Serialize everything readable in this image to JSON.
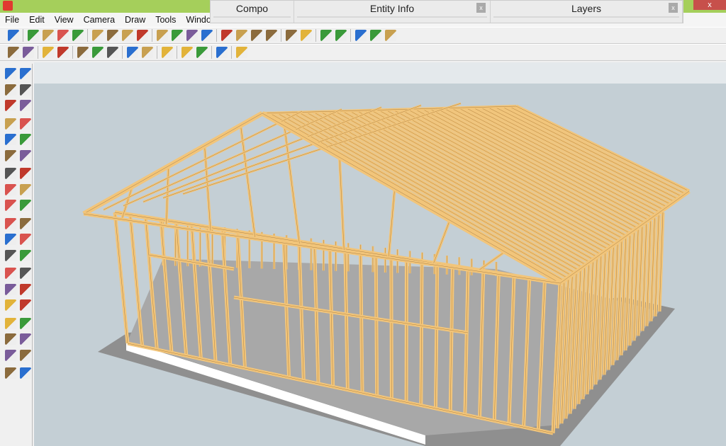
{
  "window": {
    "close_label": "x"
  },
  "menu": [
    "File",
    "Edit",
    "View",
    "Camera",
    "Draw",
    "Tools",
    "Window"
  ],
  "panels": [
    {
      "title": "Compo"
    },
    {
      "title": "Entity Info",
      "close": "x"
    },
    {
      "title": "Layers",
      "close": "x"
    }
  ],
  "colors": {
    "titlebar": "#a5cf5b",
    "wood": "#f2c57a",
    "sky": "#c4cfd5",
    "ground": "#9a9a9a"
  },
  "toolbar1": [
    "select-icon",
    "|",
    "pencil-icon",
    "rectangle-icon",
    "circle-icon",
    "arc-icon",
    "|",
    "make-component-icon",
    "eraser-icon",
    "tape-measure-icon",
    "paint-bucket-icon",
    "|",
    "push-pull-icon",
    "move-icon",
    "rotate-icon",
    "follow-me-icon",
    "|",
    "orbit-icon",
    "pan-icon",
    "zoom-icon",
    "zoom-extents-icon",
    "|",
    "get-models-icon",
    "share-model-icon",
    "|",
    "components-icon",
    "extension-icon",
    "|",
    "photo-icon",
    "styles-icon",
    "warehouse-icon"
  ],
  "toolbar2": [
    "plate-icon",
    "plate-copy-icon",
    "|",
    "stud-icon",
    "stud-copy-icon",
    "|",
    "joist-up-icon",
    "joist-copy-icon",
    "joist-down-icon",
    "|",
    "brace-icon",
    "brace-copy-icon",
    "|",
    "bounding-box-icon",
    "|",
    "undo-arrow-icon",
    "redo-arrow-icon",
    "|",
    "report-icon",
    "|",
    "label-icon"
  ],
  "lefttools": [
    "select-icon",
    "make-component-icon",
    "paint-bucket-icon",
    "eraser-icon",
    "rectangle-icon",
    "pencil-icon",
    "circle-icon",
    "arc-icon",
    "polygon-icon",
    "freehand-icon",
    "move-icon",
    "push-pull-icon",
    "rotate-icon",
    "follow-me-icon",
    "scale-icon",
    "offset-icon",
    "tape-measure-icon",
    "dimension-icon",
    "protractor-icon",
    "text-icon",
    "axes-icon",
    "3d-text-icon",
    "orbit-icon",
    "pan-icon",
    "zoom-icon",
    "zoom-window-icon",
    "zoom-extents-icon",
    "previous-view-icon",
    "position-camera-icon",
    "look-around-icon",
    "walk-icon",
    "section-plane-icon",
    "warehouse-icon",
    "share-icon",
    "home-icon",
    "layout-icon",
    "house-icon",
    "layer-icon"
  ]
}
